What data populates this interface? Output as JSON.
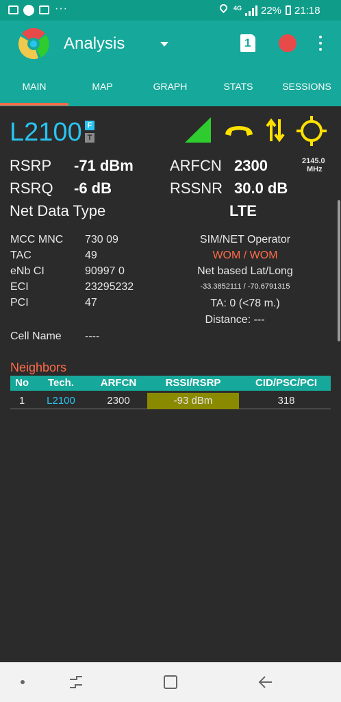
{
  "status_bar": {
    "battery": "22%",
    "time": "21:18",
    "network": "4G"
  },
  "app_bar": {
    "title": "Analysis",
    "sim_badge": "1"
  },
  "tabs": [
    {
      "label": "MAIN"
    },
    {
      "label": "MAP"
    },
    {
      "label": "GRAPH"
    },
    {
      "label": "STATS"
    },
    {
      "label": "SESSIONS"
    }
  ],
  "cell": {
    "tech": "L2100",
    "badge_f": "F",
    "badge_t": "T",
    "freq_value": "2145.0",
    "freq_unit": "MHz"
  },
  "signal": {
    "rsrp_label": "RSRP",
    "rsrp_value": "-71 dBm",
    "arfcn_label": "ARFCN",
    "arfcn_value": "2300",
    "rsrq_label": "RSRQ",
    "rsrq_value": "-6 dB",
    "rssnr_label": "RSSNR",
    "rssnr_value": "30.0 dB",
    "net_label": "Net Data Type",
    "net_value": "LTE"
  },
  "info": {
    "mcc_label": "MCC MNC",
    "mcc_value": "730 09",
    "tac_label": "TAC",
    "tac_value": "49",
    "enb_label": "eNb CI",
    "enb_value": "90997 0",
    "eci_label": "ECI",
    "eci_value": "23295232",
    "pci_label": "PCI",
    "pci_value": "47",
    "cellname_label": "Cell Name",
    "cellname_value": "----",
    "operator_label": "SIM/NET Operator",
    "operator_value": "WOM / WOM",
    "latlong_label": "Net based Lat/Long",
    "latlong_value": "-33.3852111 / -70.6791315",
    "ta": "TA: 0 (<78 m.)",
    "distance": "Distance: ---"
  },
  "neighbors": {
    "title": "Neighbors",
    "headers": [
      "No",
      "Tech.",
      "ARFCN",
      "RSSI/RSRP",
      "CID/PSC/PCI"
    ],
    "rows": [
      {
        "no": "1",
        "tech": "L2100",
        "arfcn": "2300",
        "rssi": "-93 dBm",
        "cid": "318"
      }
    ]
  },
  "colors": {
    "accent_teal": "#16a89a",
    "tab_indicator": "#ff6b4a",
    "tech_blue": "#29c4f0",
    "operator_orange": "#ff6b4a",
    "icon_yellow": "#ffe100",
    "signal_green": "#2ecc2e",
    "rssi_cell": "#8a8a00",
    "record_red": "#e84a4a"
  },
  "icons": {
    "app_logo": "radiation-fan-logo",
    "dropdown": "caret-down-icon",
    "signal": "signal-triangle-icon",
    "call": "phone-call-icon",
    "data": "updown-arrows-icon",
    "gps": "gps-target-icon"
  }
}
